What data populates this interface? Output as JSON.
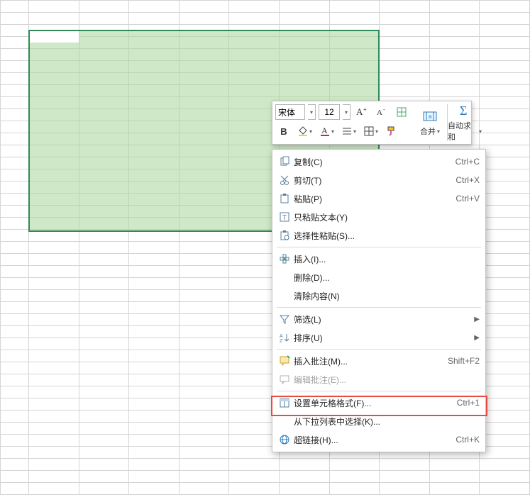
{
  "miniToolbar": {
    "fontName": "宋体",
    "fontSize": "12",
    "mergeLabel": "合并",
    "autosumLabel": "自动求和"
  },
  "contextMenu": {
    "items": [
      {
        "icon": "copy",
        "label": "复制(C)",
        "shortcut": "Ctrl+C"
      },
      {
        "icon": "cut",
        "label": "剪切(T)",
        "shortcut": "Ctrl+X"
      },
      {
        "icon": "paste",
        "label": "粘贴(P)",
        "shortcut": "Ctrl+V"
      },
      {
        "icon": "textonly",
        "label": "只粘贴文本(Y)",
        "shortcut": ""
      },
      {
        "icon": "special",
        "label": "选择性粘贴(S)...",
        "shortcut": ""
      },
      {
        "sep": true
      },
      {
        "icon": "insert",
        "label": "插入(I)...",
        "shortcut": ""
      },
      {
        "icon": "",
        "label": "删除(D)...",
        "shortcut": ""
      },
      {
        "icon": "",
        "label": "清除内容(N)",
        "shortcut": ""
      },
      {
        "sep": true
      },
      {
        "icon": "filter",
        "label": "筛选(L)",
        "shortcut": "",
        "submenu": true
      },
      {
        "icon": "sort",
        "label": "排序(U)",
        "shortcut": "",
        "submenu": true
      },
      {
        "sep": true
      },
      {
        "icon": "comment",
        "label": "插入批注(M)...",
        "shortcut": "Shift+F2"
      },
      {
        "icon": "editcomm",
        "label": "编辑批注(E)...",
        "shortcut": "",
        "disabled": true
      },
      {
        "sep": true
      },
      {
        "icon": "format",
        "label": "设置单元格格式(F)...",
        "shortcut": "Ctrl+1",
        "highlight": true
      },
      {
        "icon": "",
        "label": "从下拉列表中选择(K)...",
        "shortcut": ""
      },
      {
        "icon": "link",
        "label": "超链接(H)...",
        "shortcut": "Ctrl+K"
      }
    ]
  }
}
